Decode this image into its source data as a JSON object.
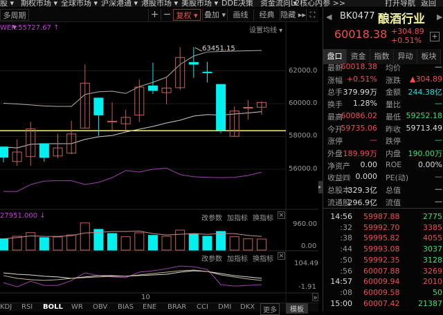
{
  "top_menu": [
    "股 ▾",
    "期权市场 ▾",
    "全球市场 ▾",
    "沪深港通 ▾",
    "港股市场 ▾",
    "美股市场 ▾",
    "DDE决策",
    "资金流向 ▾",
    "L2核心内参 >>",
    "打开导航",
    "返回"
  ],
  "toolbar": {
    "period": "多周期 ▾",
    "zoom_in": "+",
    "zoom_out": "−",
    "fuquan": "复权 ▾",
    "overlay": "叠加 ▾",
    "draw": "画线",
    "classic": "经典",
    "hide": "隐藏 ▸▸",
    "fullscreen": "⛶"
  },
  "main_panel": {
    "indicator_readout": "WER:55727.67 ↑",
    "set_ma": "设置均线 ▾",
    "high_label": "63451.15",
    "axis": [
      "62000.0",
      "60000.0",
      "58000.0",
      "56000.0"
    ]
  },
  "volume_panel": {
    "readout": "27951.000 ↓",
    "edit": "改参数",
    "add": "加指标",
    "swap": "换指标",
    "close": "×",
    "axis": [
      "960.00",
      "0.00"
    ]
  },
  "ind_panel": {
    "edit": "改参数",
    "add": "加指标",
    "swap": "换指标",
    "close": "×",
    "axis": [
      "104.49",
      "-1.91"
    ]
  },
  "time_label": "10",
  "expand": "»",
  "bottom_tabs": [
    "KDJ",
    "RSI",
    "BOLL",
    "WR",
    "OBV",
    "BIAS",
    "ENE",
    "BRAR",
    "CCI",
    "DMI",
    "DKX",
    "更多",
    "模板"
  ],
  "quote": {
    "code": "BK0477",
    "name": "酿酒行业",
    "price": "60018.38",
    "change": "+304.89",
    "pct": "+0.51%",
    "add": "+",
    "tabs": [
      "盘口",
      "资金",
      "指数",
      "异动",
      "板块"
    ],
    "rows": [
      [
        "最新",
        "60018.38",
        "red",
        "均价",
        "—",
        "wht"
      ],
      [
        "涨幅",
        "+0.51%",
        "red",
        "涨跌",
        "▲304.89",
        "red"
      ],
      [
        "总手",
        "379.99万",
        "wht",
        "金额",
        "244.38亿",
        "cyn"
      ],
      [
        "换手",
        "1.28%",
        "wht",
        "量比",
        "—",
        "grn"
      ],
      [
        "最高",
        "60086.02",
        "red",
        "最低",
        "59252.18",
        "grn"
      ],
      [
        "今开",
        "59735.06",
        "red",
        "昨收",
        "59713.49",
        "wht"
      ],
      [
        "涨停",
        "—",
        "red",
        "跌停",
        "—",
        "grn"
      ],
      [
        "外盘",
        "189.99万",
        "red",
        "内盘",
        "190.00万",
        "grn"
      ],
      [
        "净资产",
        "0.00",
        "wht",
        "ROE",
        "0.00%",
        "wht"
      ],
      [
        "收益㈣",
        "0.000",
        "wht",
        "PE(动)",
        "—",
        "gry"
      ],
      [
        "总股本",
        "329.3亿",
        "wht",
        "总值",
        "—",
        "wht"
      ],
      [
        "流通股",
        "296.9亿",
        "wht",
        "流值",
        "—",
        "wht"
      ]
    ]
  },
  "ticks": [
    [
      "14:56",
      "59987.88",
      "2775",
      "grn"
    ],
    [
      ":32",
      "59992.70",
      "3385",
      "red"
    ],
    [
      ":38",
      "59995.82",
      "4055",
      "red"
    ],
    [
      ":44",
      "59993.08",
      "3037",
      "grn"
    ],
    [
      ":50",
      "59992.35",
      "3128",
      "grn"
    ],
    [
      ":56",
      "60007.88",
      "3269",
      "red"
    ],
    [
      "14:57",
      "60009.94",
      "2010",
      "red"
    ],
    [
      ":08",
      "60009.58",
      "50",
      "grn"
    ],
    [
      "15:00",
      "60007.42",
      "21387",
      "grn"
    ]
  ],
  "colors": {
    "up": "#c8605a",
    "down": "#00f0f0",
    "support": "#ffff33",
    "purple": "#a040b0"
  },
  "chart_data": {
    "type": "candlestick",
    "ylim": [
      54000,
      64500
    ],
    "support_line": 58345,
    "high_marker": 63451.15,
    "candles": [
      [
        57360,
        57360,
        56420,
        56730
      ],
      [
        56470,
        57820,
        56210,
        57050
      ],
      [
        56770,
        58880,
        56210,
        58460
      ],
      [
        57560,
        57560,
        56450,
        56720
      ],
      [
        56810,
        58150,
        56660,
        57300
      ],
      [
        56980,
        58950,
        56920,
        58150
      ],
      [
        58510,
        62390,
        58510,
        61250
      ],
      [
        60340,
        60340,
        58030,
        59310
      ],
      [
        58880,
        60070,
        58350,
        58930
      ],
      [
        58770,
        59620,
        58350,
        59160
      ],
      [
        59300,
        61470,
        58880,
        61010
      ],
      [
        61080,
        62500,
        60590,
        60800
      ],
      [
        60670,
        61610,
        59970,
        60950
      ],
      [
        60970,
        63440,
        60840,
        62810
      ],
      [
        62510,
        63451.15,
        61570,
        62400
      ],
      [
        61920,
        62550,
        61290,
        61880
      ],
      [
        61170,
        61170,
        58200,
        58390
      ],
      [
        58010,
        59830,
        58010,
        59550
      ],
      [
        59730,
        60210,
        59020,
        59770
      ],
      [
        59780,
        60140,
        59330,
        60070
      ]
    ],
    "boll_upper": [
      60020,
      59980,
      59920,
      59860,
      59830,
      59830,
      60560,
      60720,
      60760,
      60620,
      61040,
      61300,
      61610,
      62390,
      62900,
      63150,
      63180,
      63200,
      63220,
      63240
    ],
    "boll_mid": [
      57360,
      57300,
      57520,
      57560,
      57560,
      57560,
      57820,
      57980,
      58060,
      58270,
      58440,
      58610,
      58820,
      58990,
      59240,
      59330,
      59300,
      59370,
      59430,
      59510
    ],
    "boll_lower": [
      54650,
      54650,
      55070,
      55280,
      55300,
      55300,
      55070,
      55200,
      55490,
      55920,
      55830,
      56000,
      56070,
      55680,
      55540,
      55510,
      55490,
      55510,
      55620,
      55820
    ],
    "volume": [
      447,
      549,
      694,
      494,
      521,
      603,
      1078,
      823,
      658,
      530,
      686,
      585,
      549,
      795,
      650,
      549,
      741,
      530,
      447,
      439
    ],
    "volume_up": [
      0,
      1,
      1,
      0,
      1,
      1,
      1,
      0,
      0,
      1,
      1,
      0,
      1,
      1,
      0,
      0,
      0,
      1,
      1,
      1
    ],
    "ind_line1": [
      22,
      4,
      28,
      10,
      10,
      31,
      65,
      53,
      47,
      44,
      68,
      74,
      83,
      95,
      92,
      80,
      13,
      7,
      10,
      13
    ],
    "ind_line2": [
      65,
      59,
      56,
      50,
      47,
      41,
      47,
      53,
      53,
      50,
      53,
      56,
      59,
      68,
      74,
      71,
      62,
      53,
      47,
      41
    ],
    "ind_line3": [
      53,
      41,
      35,
      32,
      35,
      41,
      44,
      47,
      50,
      50,
      56,
      62,
      68,
      74,
      77,
      71,
      56,
      47,
      38,
      32
    ]
  }
}
